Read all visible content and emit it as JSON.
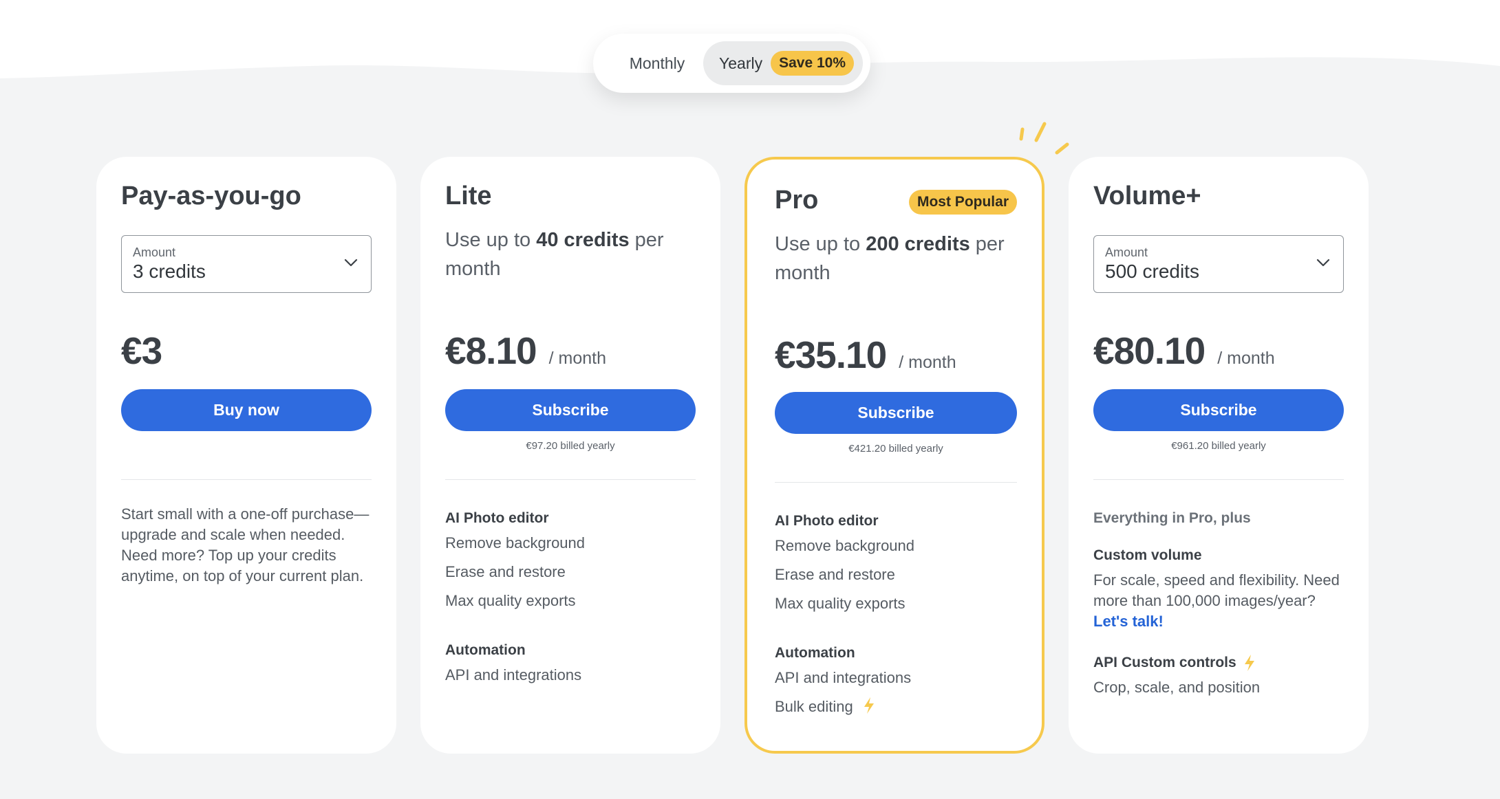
{
  "toggle": {
    "monthly_label": "Monthly",
    "yearly_label": "Yearly",
    "save_badge": "Save 10%"
  },
  "plans": [
    {
      "title": "Pay-as-you-go",
      "select_label": "Amount",
      "select_value": "3 credits",
      "price": "€3",
      "cta": "Buy now",
      "description": "Start small with a one-off purchase—upgrade and scale when needed. Need more? Top up your credits anytime, on top of your current plan."
    },
    {
      "title": "Lite",
      "desc_prefix": "Use up to ",
      "desc_bold": "40 credits",
      "desc_suffix": " per month",
      "price": "€8.10",
      "per": "/ month",
      "cta": "Subscribe",
      "billed": "€97.20 billed yearly",
      "feature_groups": [
        {
          "heading": "AI Photo editor",
          "items": [
            "Remove background",
            "Erase and restore",
            "Max quality exports"
          ]
        },
        {
          "heading": "Automation",
          "items": [
            "API and integrations"
          ]
        }
      ]
    },
    {
      "title": "Pro",
      "badge": "Most Popular",
      "desc_prefix": "Use up to ",
      "desc_bold": "200 credits",
      "desc_suffix": " per month",
      "price": "€35.10",
      "per": "/ month",
      "cta": "Subscribe",
      "billed": "€421.20 billed yearly",
      "feature_groups": [
        {
          "heading": "AI Photo editor",
          "items": [
            "Remove background",
            "Erase and restore",
            "Max quality exports"
          ]
        },
        {
          "heading": "Automation",
          "items": [
            "API and integrations",
            "Bulk editing"
          ]
        }
      ]
    },
    {
      "title": "Volume+",
      "select_label": "Amount",
      "select_value": "500 credits",
      "price": "€80.10",
      "per": "/ month",
      "cta": "Subscribe",
      "billed": "€961.20 billed yearly",
      "intro": "Everything in Pro, plus",
      "custom_heading": "Custom volume",
      "custom_text": "For scale, speed and flexibility. Need more than 100,000 images/year? ",
      "custom_link": "Let's talk!",
      "api_heading": "API Custom controls",
      "api_item": "Crop, scale, and position"
    }
  ],
  "icons": {
    "select_chevron": "chevron-down-icon",
    "bolt": "lightning-bolt-icon",
    "accent_burst": "sparkle-burst-icon"
  },
  "colors": {
    "primary": "#2f6bdf",
    "accent": "#f7c54a",
    "background": "#f3f4f5",
    "card": "#ffffff",
    "text": "#3b4046"
  }
}
